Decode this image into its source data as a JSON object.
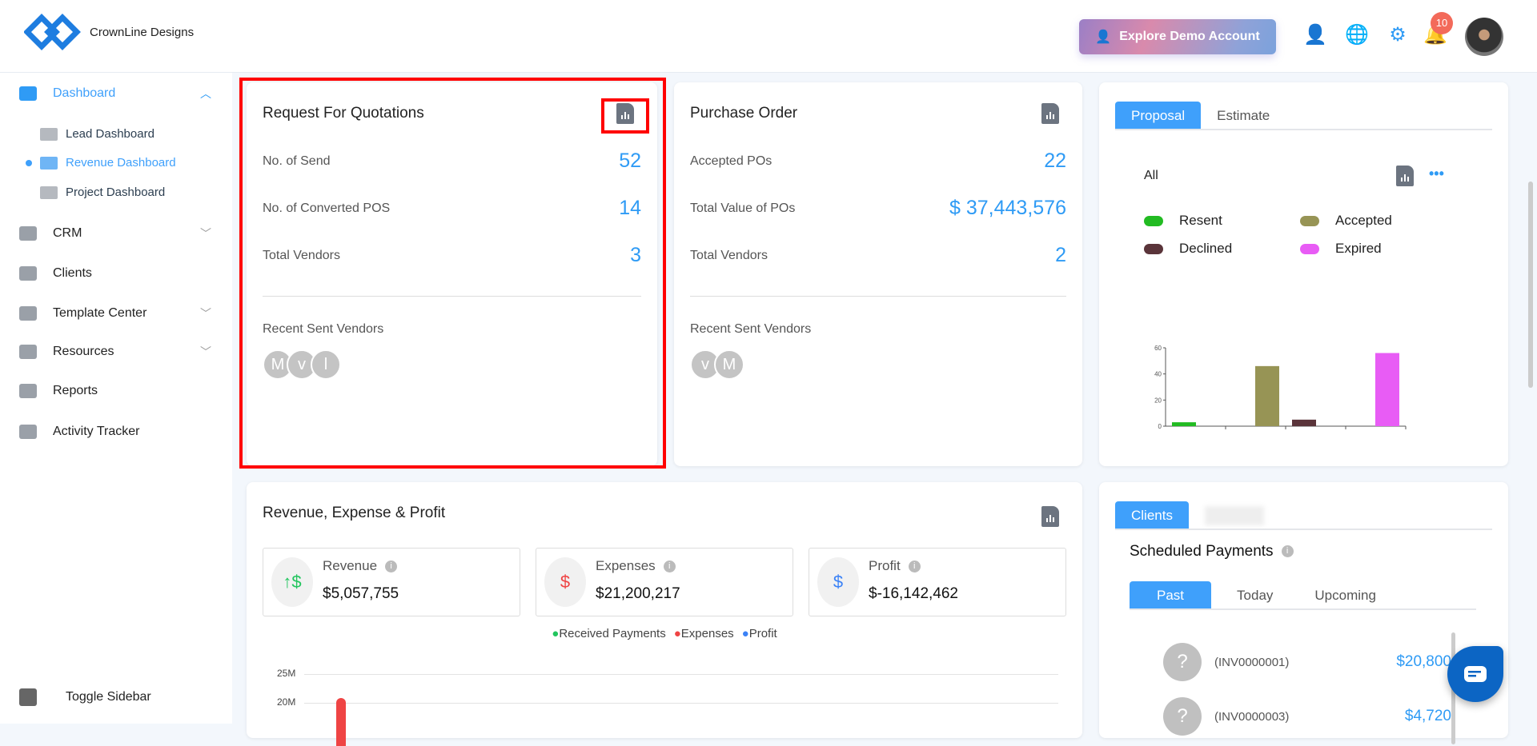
{
  "header": {
    "brand": "CrownLine Designs",
    "demo_button": "Explore Demo Account",
    "notification_count": "10"
  },
  "sidebar": {
    "dashboard": "Dashboard",
    "sub": [
      "Lead Dashboard",
      "Revenue Dashboard",
      "Project Dashboard"
    ],
    "items": [
      "CRM",
      "Clients",
      "Template Center",
      "Resources",
      "Reports",
      "Activity Tracker"
    ],
    "toggle": "Toggle Sidebar"
  },
  "rfq": {
    "title": "Request For Quotations",
    "rows": [
      {
        "label": "No. of Send",
        "value": "52"
      },
      {
        "label": "No. of Converted POS",
        "value": "14"
      },
      {
        "label": "Total Vendors",
        "value": "3"
      }
    ],
    "recent_label": "Recent Sent Vendors",
    "avatars": [
      "M",
      "v",
      "l"
    ]
  },
  "po": {
    "title": "Purchase Order",
    "rows": [
      {
        "label": "Accepted POs",
        "value": "22"
      },
      {
        "label": "Total Value of POs",
        "value": "$ 37,443,576"
      },
      {
        "label": "Total Vendors",
        "value": "2"
      }
    ],
    "recent_label": "Recent Sent Vendors",
    "avatars": [
      "v",
      "M"
    ]
  },
  "proposal": {
    "tabs": [
      "Proposal",
      "Estimate"
    ],
    "filter": "All",
    "more": "•••"
  },
  "chart_data": [
    {
      "type": "bar",
      "title": "Proposal",
      "categories": [
        "Resent",
        "Accepted",
        "Declined",
        "Expired"
      ],
      "values": [
        3,
        46,
        5,
        56
      ],
      "colors": [
        "#22bb22",
        "#979455",
        "#5a343a",
        "#e85cf5"
      ],
      "ylim": [
        0,
        60
      ],
      "yticks": [
        "0",
        "20",
        "40",
        "60"
      ],
      "legend": "top"
    },
    {
      "type": "bar",
      "title": "Revenue, Expense & Profit",
      "series": [
        {
          "name": "Received Payments",
          "color": "#22c55e"
        },
        {
          "name": "Expenses",
          "color": "#ef4444"
        },
        {
          "name": "Profit",
          "color": "#3b82f6"
        }
      ],
      "yticks": [
        "25M",
        "20M"
      ],
      "visible_values": {
        "Expenses": 21200217
      }
    }
  ],
  "rep": {
    "title": "Revenue, Expense & Profit",
    "stats": [
      {
        "label": "Revenue",
        "value": "$5,057,755"
      },
      {
        "label": "Expenses",
        "value": "$21,200,217"
      },
      {
        "label": "Profit",
        "value": "$-16,142,462"
      }
    ],
    "legend": [
      "Received Payments",
      "Expenses",
      "Profit"
    ],
    "yticks": [
      "25M",
      "20M"
    ]
  },
  "payments": {
    "tab": "Clients",
    "title": "Scheduled Payments",
    "subtabs": [
      "Past",
      "Today",
      "Upcoming"
    ],
    "rows": [
      {
        "invoice": "(INV0000001)",
        "amount": "$20,800"
      },
      {
        "invoice": "(INV0000003)",
        "amount": "$4,720"
      }
    ]
  }
}
